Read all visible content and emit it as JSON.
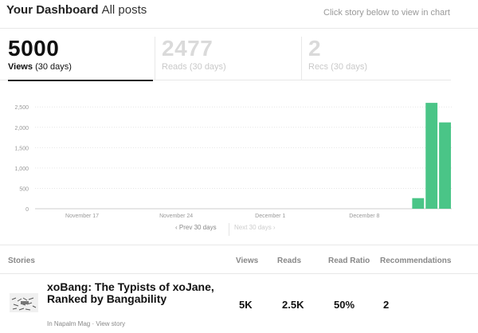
{
  "header": {
    "title": "Your Dashboard",
    "subtitle": "All posts",
    "hint": "Click story below to view in chart"
  },
  "stats": [
    {
      "value": "5000",
      "label": "Views",
      "period": "(30 days)",
      "active": true
    },
    {
      "value": "2477",
      "label": "Reads",
      "period": "(30 days)",
      "active": false
    },
    {
      "value": "2",
      "label": "Recs",
      "period": "(30 days)",
      "active": false
    }
  ],
  "chart_data": {
    "type": "bar",
    "y_ticks": [
      0,
      500,
      1000,
      1500,
      2000,
      2500
    ],
    "ylim": [
      0,
      2700
    ],
    "x_tick_labels": [
      "November 17",
      "November 24",
      "December 1",
      "December 8"
    ],
    "bar_color": "#4ac587",
    "values": [
      0,
      0,
      0,
      0,
      0,
      0,
      0,
      0,
      0,
      0,
      0,
      0,
      0,
      0,
      0,
      0,
      0,
      0,
      0,
      0,
      0,
      0,
      0,
      0,
      0,
      0,
      0,
      0,
      260,
      2600,
      2120
    ]
  },
  "pager": {
    "prev_label": "Prev 30 days",
    "next_label": "Next 30 days"
  },
  "table": {
    "headers": {
      "stories": "Stories",
      "views": "Views",
      "reads": "Reads",
      "read_ratio": "Read Ratio",
      "recommendations": "Recommendations"
    },
    "rows": [
      {
        "title": "xoBang: The Typists of xoJane, Ranked by Bangability",
        "publication": "In Napalm Mag",
        "separator": "·",
        "view_link": "View story",
        "views": "5K",
        "reads": "2.5K",
        "read_ratio": "50%",
        "recommendations": "2"
      }
    ]
  }
}
